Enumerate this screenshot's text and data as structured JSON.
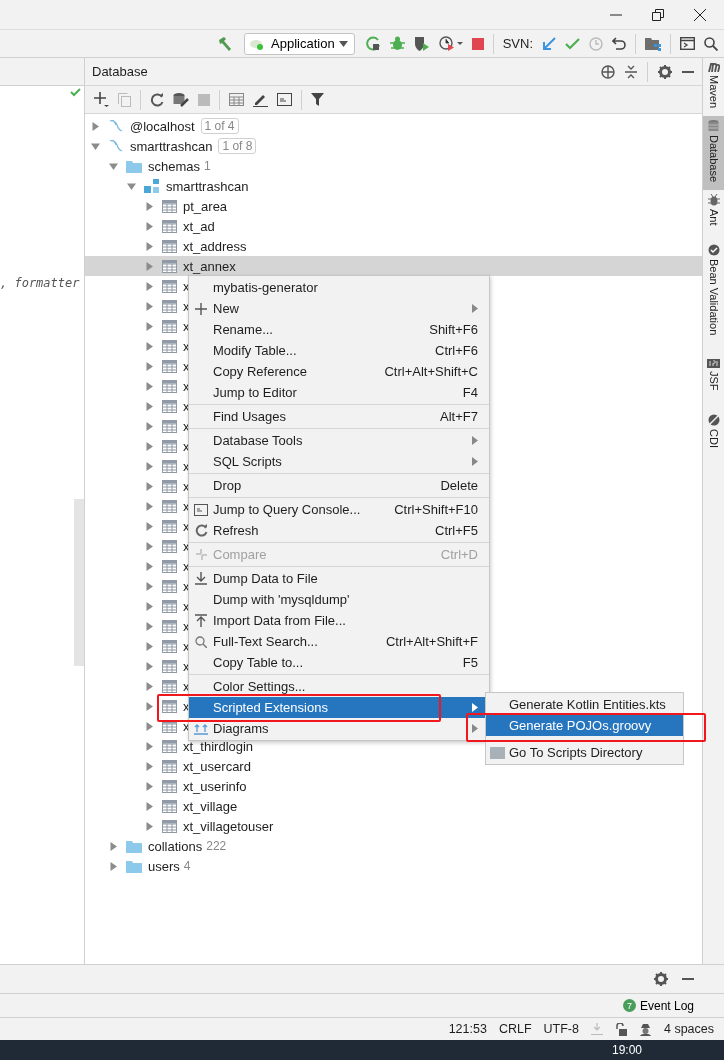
{
  "toolbar": {
    "run_config": "Application",
    "svn_label": "SVN:"
  },
  "editor": {
    "code_fragment": ", formatter"
  },
  "database_panel": {
    "title": "Database",
    "tree": [
      {
        "label": "@localhost",
        "badge": "1 of 4",
        "kind": "datasource",
        "expanded": false,
        "selected": false
      },
      {
        "label": "smarttrashcan",
        "badge": "1 of 8",
        "kind": "datasource",
        "expanded": true,
        "selected": false,
        "children": [
          {
            "label": "schemas",
            "count": "1",
            "kind": "folder",
            "expanded": true,
            "selected": false,
            "children": [
              {
                "label": "smarttrashcan",
                "kind": "schema",
                "expanded": true,
                "selected": false,
                "children": [
                  {
                    "label": "pt_area",
                    "kind": "table",
                    "expanded": false,
                    "selected": false
                  },
                  {
                    "label": "xt_ad",
                    "kind": "table",
                    "expanded": false,
                    "selected": false
                  },
                  {
                    "label": "xt_address",
                    "kind": "table",
                    "expanded": false,
                    "selected": false
                  },
                  {
                    "label": "xt_annex",
                    "kind": "table",
                    "expanded": false,
                    "selected": true
                  },
                  {
                    "label": "x",
                    "kind": "table",
                    "expanded": false,
                    "selected": false
                  },
                  {
                    "label": "x",
                    "kind": "table",
                    "expanded": false,
                    "selected": false
                  },
                  {
                    "label": "x",
                    "kind": "table",
                    "expanded": false,
                    "selected": false
                  },
                  {
                    "label": "x",
                    "kind": "table",
                    "expanded": false,
                    "selected": false
                  },
                  {
                    "label": "x",
                    "kind": "table",
                    "expanded": false,
                    "selected": false
                  },
                  {
                    "label": "x",
                    "kind": "table",
                    "expanded": false,
                    "selected": false
                  },
                  {
                    "label": "x",
                    "kind": "table",
                    "expanded": false,
                    "selected": false
                  },
                  {
                    "label": "x",
                    "kind": "table",
                    "expanded": false,
                    "selected": false
                  },
                  {
                    "label": "x",
                    "kind": "table",
                    "expanded": false,
                    "selected": false
                  },
                  {
                    "label": "x",
                    "kind": "table",
                    "expanded": false,
                    "selected": false
                  },
                  {
                    "label": "x",
                    "kind": "table",
                    "expanded": false,
                    "selected": false
                  },
                  {
                    "label": "x",
                    "kind": "table",
                    "expanded": false,
                    "selected": false
                  },
                  {
                    "label": "x",
                    "kind": "table",
                    "expanded": false,
                    "selected": false
                  },
                  {
                    "label": "x",
                    "kind": "table",
                    "expanded": false,
                    "selected": false
                  },
                  {
                    "label": "x",
                    "kind": "table",
                    "expanded": false,
                    "selected": false
                  },
                  {
                    "label": "x",
                    "kind": "table",
                    "expanded": false,
                    "selected": false
                  },
                  {
                    "label": "x",
                    "kind": "table",
                    "expanded": false,
                    "selected": false
                  },
                  {
                    "label": "x",
                    "kind": "table",
                    "expanded": false,
                    "selected": false
                  },
                  {
                    "label": "x",
                    "kind": "table",
                    "expanded": false,
                    "selected": false
                  },
                  {
                    "label": "x",
                    "kind": "table",
                    "expanded": false,
                    "selected": false
                  },
                  {
                    "label": "x",
                    "kind": "table",
                    "expanded": false,
                    "selected": false
                  },
                  {
                    "label": "x",
                    "kind": "table",
                    "expanded": false,
                    "selected": false
                  },
                  {
                    "label": "x",
                    "kind": "table",
                    "expanded": false,
                    "selected": false
                  },
                  {
                    "label": "xt_thirdlogin",
                    "kind": "table",
                    "expanded": false,
                    "selected": false
                  },
                  {
                    "label": "xt_usercard",
                    "kind": "table",
                    "expanded": false,
                    "selected": false
                  },
                  {
                    "label": "xt_userinfo",
                    "kind": "table",
                    "expanded": false,
                    "selected": false
                  },
                  {
                    "label": "xt_village",
                    "kind": "table",
                    "expanded": false,
                    "selected": false
                  },
                  {
                    "label": "xt_villagetouser",
                    "kind": "table",
                    "expanded": false,
                    "selected": false
                  }
                ]
              }
            ]
          },
          {
            "label": "collations",
            "count": "222",
            "kind": "folder",
            "expanded": false,
            "selected": false
          },
          {
            "label": "users",
            "count": "4",
            "kind": "folder",
            "expanded": false,
            "selected": false
          }
        ]
      }
    ]
  },
  "context_menu": {
    "groups": [
      [
        {
          "label": "mybatis-generator",
          "disabled": false,
          "submenu": false,
          "selected": false
        },
        {
          "label": "New",
          "disabled": false,
          "submenu": true,
          "selected": false
        },
        {
          "label": "Rename...",
          "shortcut": "Shift+F6",
          "disabled": false,
          "submenu": false,
          "selected": false
        },
        {
          "label": "Modify Table...",
          "shortcut": "Ctrl+F6",
          "disabled": false,
          "submenu": false,
          "selected": false
        },
        {
          "label": "Copy Reference",
          "shortcut": "Ctrl+Alt+Shift+C",
          "disabled": false,
          "submenu": false,
          "selected": false
        },
        {
          "label": "Jump to Editor",
          "shortcut": "F4",
          "disabled": false,
          "submenu": false,
          "selected": false
        }
      ],
      [
        {
          "label": "Find Usages",
          "shortcut": "Alt+F7",
          "disabled": false,
          "submenu": false,
          "selected": false
        }
      ],
      [
        {
          "label": "Database Tools",
          "disabled": false,
          "submenu": true,
          "selected": false
        },
        {
          "label": "SQL Scripts",
          "disabled": false,
          "submenu": true,
          "selected": false
        }
      ],
      [
        {
          "label": "Drop",
          "shortcut": "Delete",
          "disabled": false,
          "submenu": false,
          "selected": false
        }
      ],
      [
        {
          "label": "Jump to Query Console...",
          "shortcut": "Ctrl+Shift+F10",
          "disabled": false,
          "submenu": false,
          "selected": false
        },
        {
          "label": "Refresh",
          "shortcut": "Ctrl+F5",
          "disabled": false,
          "submenu": false,
          "selected": false
        }
      ],
      [
        {
          "label": "Compare",
          "shortcut": "Ctrl+D",
          "disabled": true,
          "submenu": false,
          "selected": false
        }
      ],
      [
        {
          "label": "Dump Data to File",
          "disabled": false,
          "submenu": false,
          "selected": false
        },
        {
          "label": "Dump with 'mysqldump'",
          "disabled": false,
          "submenu": false,
          "selected": false
        },
        {
          "label": "Import Data from File...",
          "disabled": false,
          "submenu": false,
          "selected": false
        },
        {
          "label": "Full-Text Search...",
          "shortcut": "Ctrl+Alt+Shift+F",
          "disabled": false,
          "submenu": false,
          "selected": false
        },
        {
          "label": "Copy Table to...",
          "shortcut": "F5",
          "disabled": false,
          "submenu": false,
          "selected": false
        }
      ],
      [
        {
          "label": "Color Settings...",
          "disabled": false,
          "submenu": false,
          "selected": false
        },
        {
          "label": "Scripted Extensions",
          "disabled": false,
          "submenu": true,
          "selected": true
        },
        {
          "label": "Diagrams",
          "disabled": false,
          "submenu": true,
          "selected": false
        }
      ]
    ]
  },
  "submenu": {
    "items": [
      {
        "label": "Generate Kotlin Entities.kts",
        "selected": false
      },
      {
        "label": "Generate POJOs.groovy",
        "selected": true
      },
      {
        "label": "Go To Scripts Directory",
        "selected": false
      }
    ]
  },
  "side_tabs": [
    {
      "label": "Maven",
      "selected": false
    },
    {
      "label": "Database",
      "selected": true
    },
    {
      "label": "Ant",
      "selected": false
    },
    {
      "label": "Bean Validation",
      "selected": false
    },
    {
      "label": "JSF",
      "selected": false
    },
    {
      "label": "CDI",
      "selected": false
    }
  ],
  "event_log": {
    "label": "Event Log",
    "badge": "7"
  },
  "status_bar": {
    "position": "121:53",
    "line_separator": "CRLF",
    "encoding": "UTF-8",
    "indent": "4 spaces"
  },
  "taskbar": {
    "clock": "19:00"
  }
}
